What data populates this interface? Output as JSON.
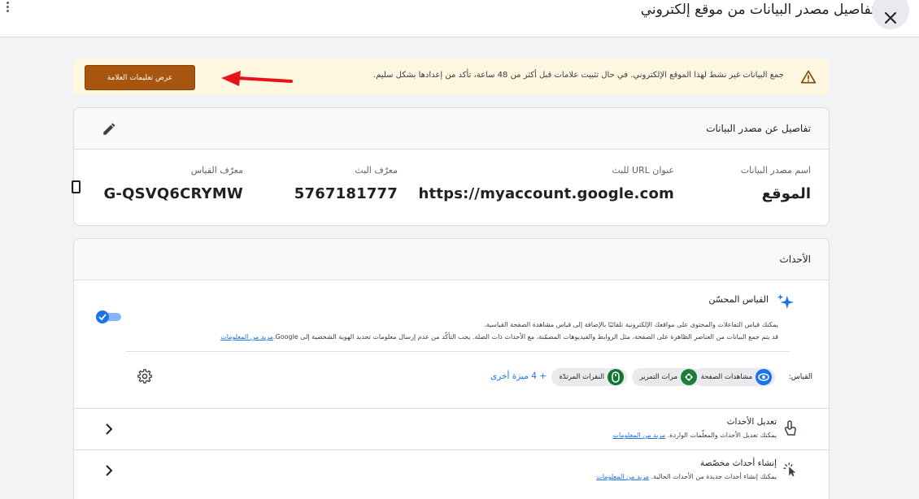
{
  "header": {
    "title": "تفاصيل مصدر البيانات من موقع إلكتروني"
  },
  "banner": {
    "message": "جمع البيانات غير نشط لهذا الموقع الإلكتروني. في حال تثبيت علامات قبل أكثر من 48 ساعة، تأكد من إعدادها بشكل سليم.",
    "button_label": "عرض تعليمات العلامة",
    "accent": "#a8550f"
  },
  "details": {
    "title": "تفاصيل عن مصدر البيانات",
    "fields": [
      {
        "label": "اسم مصدر البيانات",
        "value": "الموقع"
      },
      {
        "label": "عنوان URL للبث",
        "value": "https://myaccount.google.com"
      },
      {
        "label": "معرّف البث",
        "value": "5767181777"
      },
      {
        "label": "معرّف القياس",
        "value": "G-QSVQ6CRYMW"
      }
    ]
  },
  "events": {
    "title": "الأحداث",
    "enhanced": {
      "title": "القياس المحسّن",
      "desc_line1": "يمكنك قياس التفاعلات والمحتوى على مواقعك الإلكترونية تلقائيًا بالإضافة إلى قياس مشاهدة الصفحة القياسية.",
      "desc_line2": "قد يتم جمع البيانات من العناصر الظاهرة على الصفحة، مثل الروابط والفيديوهات المضمّنة، مع الأحداث ذات الصلة. يجب التأكّد من عدم إرسال معلومات تحديد الهوية الشخصية إلى Google.",
      "learn_more": "مزيد من المعلومات",
      "toggle_on": true,
      "measure_label": "القياس:",
      "chips": [
        {
          "label": "مشاهدات الصفحة",
          "icon": "eye-icon",
          "color": "#1a73e8"
        },
        {
          "label": "مرات التمرير",
          "icon": "scroll-icon",
          "color": "#188038"
        },
        {
          "label": "النقرات المرتدّة",
          "icon": "mouse-icon",
          "color": "#137333"
        }
      ],
      "more": "+ 4 ميزة أخرى"
    },
    "rows": [
      {
        "title": "تعديل الأحداث",
        "desc": "يمكنك تعديل الأحداث والمعلّمات الواردة.",
        "link": "مزيد من المعلومات"
      },
      {
        "title": "إنشاء أحداث مخصّصة",
        "desc": "يمكنك إنشاء أحداث جديدة من الأحداث الحالية.",
        "link": "مزيد من المعلومات"
      }
    ]
  }
}
